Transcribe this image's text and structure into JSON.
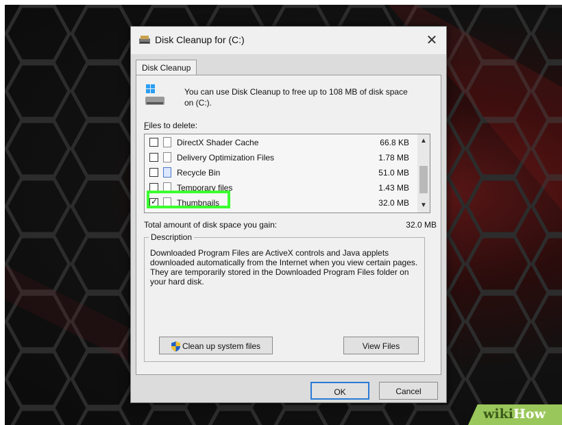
{
  "dialog": {
    "title": "Disk Cleanup for  (C:)",
    "close_glyph": "✕",
    "tab": "Disk Cleanup",
    "intro": "You can use Disk Cleanup to free up to 108 MB of disk space on  (C:).",
    "files_label_accel": "F",
    "files_label_rest": "iles to delete:",
    "files": [
      {
        "name": "DirectX Shader Cache",
        "size": "66.8 KB",
        "checked": false,
        "icon": "file-icon"
      },
      {
        "name": "Delivery Optimization Files",
        "size": "1.78 MB",
        "checked": false,
        "icon": "file-icon"
      },
      {
        "name": "Recycle Bin",
        "size": "51.0 MB",
        "checked": false,
        "icon": "recycle-bin-icon"
      },
      {
        "name": "Temporary files",
        "size": "1.43 MB",
        "checked": false,
        "icon": "file-icon"
      },
      {
        "name": "Thumbnails",
        "size": "32.0 MB",
        "checked": true,
        "icon": "file-icon"
      }
    ],
    "check_glyph": "✓",
    "total_label": "Total amount of disk space you gain:",
    "total_value": "32.0 MB",
    "description_legend": "Description",
    "description": "Downloaded Program Files are ActiveX controls and Java applets downloaded automatically from the Internet when you view certain pages. They are temporarily stored in the Downloaded Program Files folder on your hard disk.",
    "buttons": {
      "cleanup_system": "Clean up system files",
      "view_files": "View Files",
      "ok": "OK",
      "cancel": "Cancel"
    }
  },
  "watermark": {
    "part1": "wiki",
    "part2": "How"
  },
  "colors": {
    "highlight": "#3bff2f",
    "watermark_bg": "#9ac75b",
    "ok_border": "#2a7ad8"
  }
}
